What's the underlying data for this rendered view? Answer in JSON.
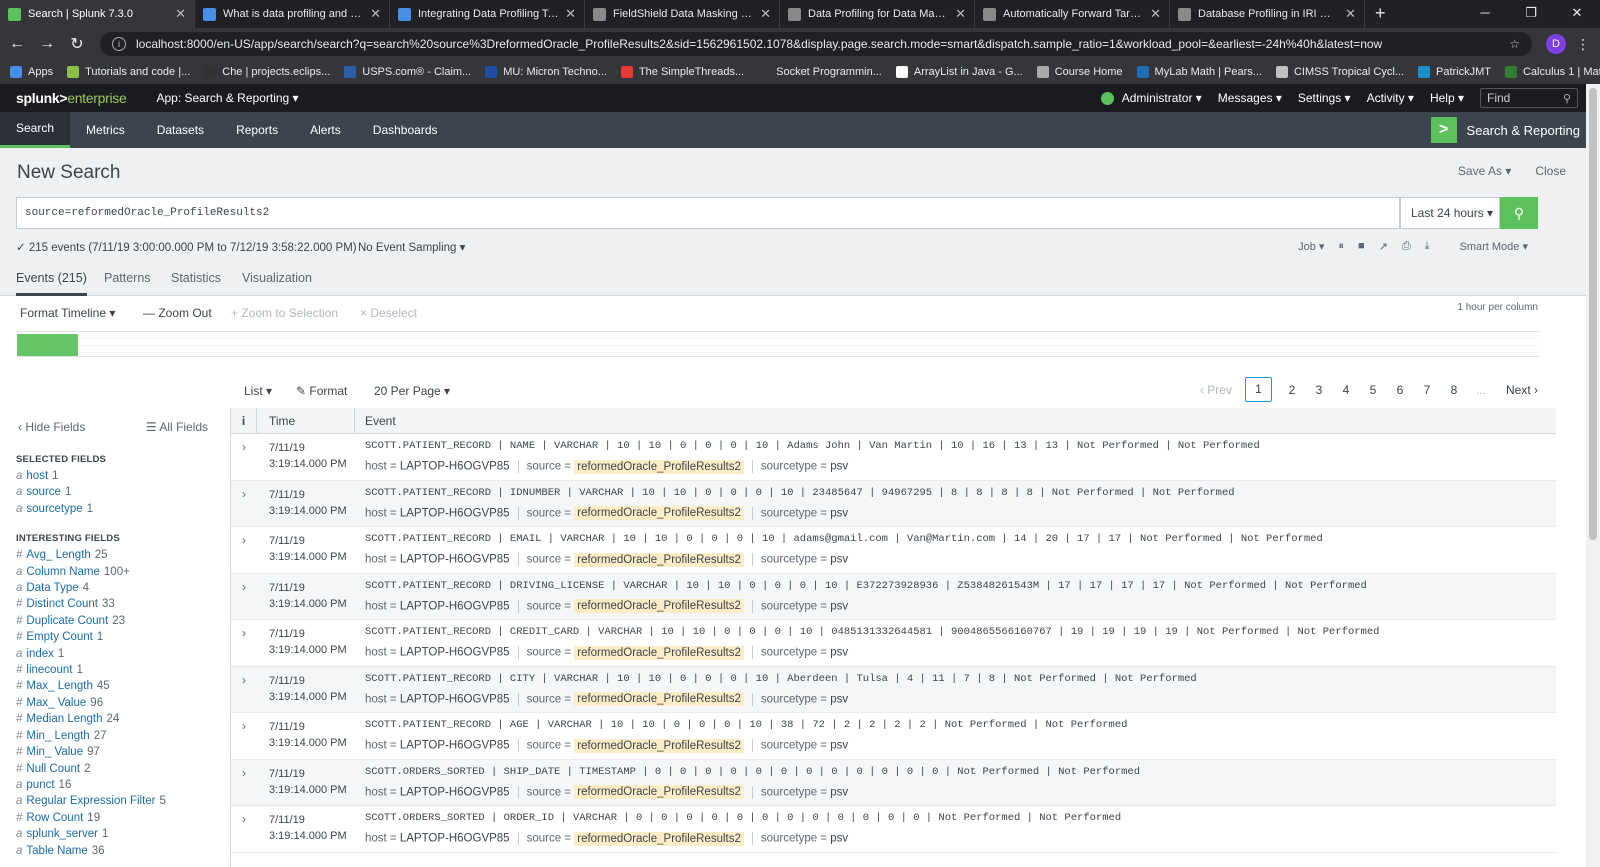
{
  "browser": {
    "tabs": [
      {
        "title": "Search | Splunk 7.3.0",
        "active": true,
        "color": "#5cc05c"
      },
      {
        "title": "What is data profiling and how d",
        "active": false,
        "color": "#4a8fe7"
      },
      {
        "title": "Integrating Data Profiling Tools i",
        "active": false,
        "color": "#4a8fe7"
      },
      {
        "title": "FieldShield Data Masking Softwa",
        "active": false,
        "color": "#888888"
      },
      {
        "title": "Data Profiling for Data Masking i",
        "active": false,
        "color": "#888888"
      },
      {
        "title": "Automatically Forward Target or",
        "active": false,
        "color": "#888888"
      },
      {
        "title": "Database Profiling in IRI Workbe",
        "active": false,
        "color": "#888888"
      }
    ],
    "url": "localhost:8000/en-US/app/search/search?q=search%20source%3DreformedOracle_ProfileResults2&sid=1562961502.1078&display.page.search.mode=smart&dispatch.sample_ratio=1&workload_pool=&earliest=-24h%40h&latest=now",
    "profile_initial": "D",
    "bookmarks": [
      {
        "label": "Apps",
        "color": "#4a8fe7"
      },
      {
        "label": "Tutorials and code |...",
        "color": "#8bc34a"
      },
      {
        "label": "Che | projects.eclips...",
        "color": "#333333"
      },
      {
        "label": "USPS.com® - Claim...",
        "color": "#2b5ea8"
      },
      {
        "label": "MU: Micron Techno...",
        "color": "#1f4fa0"
      },
      {
        "label": "The SimpleThreads...",
        "color": "#e53935"
      },
      {
        "label": "Socket Programmin...",
        "color": "#35363a"
      },
      {
        "label": "ArrayList in Java - G...",
        "color": "#ffffff"
      },
      {
        "label": "Course Home",
        "color": "#aaaaaa"
      },
      {
        "label": "MyLab Math | Pears...",
        "color": "#1f6fb2"
      },
      {
        "label": "CIMSS Tropical Cycl...",
        "color": "#c0c0c0"
      },
      {
        "label": "PatrickJMT",
        "color": "#1e90c9"
      },
      {
        "label": "Calculus 1 | Math |...",
        "color": "#2e7d32"
      }
    ]
  },
  "splunk": {
    "logo_main": "splunk>",
    "logo_sub": "enterprise",
    "app_menu": "App: Search & Reporting ▾",
    "top_menu": [
      "Administrator ▾",
      "Messages ▾",
      "Settings ▾",
      "Activity ▾",
      "Help ▾"
    ],
    "find_placeholder": "Find",
    "nav": [
      "Search",
      "Metrics",
      "Datasets",
      "Reports",
      "Alerts",
      "Dashboards"
    ],
    "app_badge": "Search & Reporting",
    "page_title": "New Search",
    "save_as": "Save As ▾",
    "close": "Close",
    "query": "source=reformedOracle_ProfileResults2",
    "time_range": "Last 24 hours ▾",
    "job_status": "✓ 215 events (7/11/19 3:00:00.000 PM to 7/12/19 3:58:22.000 PM)",
    "sampling": "No Event Sampling ▾",
    "job_menu": "Job ▾",
    "mode": "Smart Mode ▾",
    "sub_tabs": [
      "Events (215)",
      "Patterns",
      "Statistics",
      "Visualization"
    ],
    "timeline": {
      "format": "Format Timeline ▾",
      "zoom_out": "— Zoom Out",
      "zoom_sel": "+ Zoom to Selection",
      "deselect": "× Deselect",
      "scale": "1 hour per column"
    },
    "results_bar": {
      "list": "List ▾",
      "format": "✎ Format",
      "per_page": "20 Per Page ▾",
      "prev": "‹ Prev",
      "pages": [
        "1",
        "2",
        "3",
        "4",
        "5",
        "6",
        "7",
        "8"
      ],
      "ellipsis": "...",
      "next": "Next ›"
    },
    "sidebar": {
      "hide_fields": "‹ Hide Fields",
      "all_fields": "☰ All Fields",
      "selected_title": "SELECTED FIELDS",
      "selected": [
        {
          "type": "a",
          "name": "host",
          "count": "1"
        },
        {
          "type": "a",
          "name": "source",
          "count": "1"
        },
        {
          "type": "a",
          "name": "sourcetype",
          "count": "1"
        }
      ],
      "interesting_title": "INTERESTING FIELDS",
      "interesting": [
        {
          "type": "#",
          "name": "Avg_ Length",
          "count": "25"
        },
        {
          "type": "a",
          "name": "Column Name",
          "count": "100+"
        },
        {
          "type": "a",
          "name": "Data Type",
          "count": "4"
        },
        {
          "type": "#",
          "name": "Distinct Count",
          "count": "33"
        },
        {
          "type": "#",
          "name": "Duplicate Count",
          "count": "23"
        },
        {
          "type": "#",
          "name": "Empty Count",
          "count": "1"
        },
        {
          "type": "a",
          "name": "index",
          "count": "1"
        },
        {
          "type": "#",
          "name": "linecount",
          "count": "1"
        },
        {
          "type": "#",
          "name": "Max_ Length",
          "count": "45"
        },
        {
          "type": "#",
          "name": "Max_ Value",
          "count": "96"
        },
        {
          "type": "#",
          "name": "Median Length",
          "count": "24"
        },
        {
          "type": "#",
          "name": "Min_ Length",
          "count": "27"
        },
        {
          "type": "#",
          "name": "Min_ Value",
          "count": "97"
        },
        {
          "type": "#",
          "name": "Null Count",
          "count": "2"
        },
        {
          "type": "a",
          "name": "punct",
          "count": "16"
        },
        {
          "type": "a",
          "name": "Regular Expression Filter",
          "count": "5"
        },
        {
          "type": "#",
          "name": "Row Count",
          "count": "19"
        },
        {
          "type": "a",
          "name": "splunk_server",
          "count": "1"
        },
        {
          "type": "a",
          "name": "Table Name",
          "count": "36"
        }
      ]
    },
    "events_header": {
      "i": "i",
      "time": "Time",
      "event": "Event"
    },
    "events": [
      {
        "date": "7/11/19",
        "time": "3:19:14.000 PM",
        "raw": "SCOTT.PATIENT_RECORD | NAME | VARCHAR | 10 | 10 | 0 | 0 | 0 | 10 | Adams John | Van Martin | 10 | 16 | 13 | 13 | Not Performed | Not Performed"
      },
      {
        "date": "7/11/19",
        "time": "3:19:14.000 PM",
        "raw": "SCOTT.PATIENT_RECORD | IDNUMBER | VARCHAR | 10 | 10 | 0 | 0 | 0 | 10 | 23485647 | 94967295 | 8 | 8 | 8 | 8 | Not Performed | Not Performed"
      },
      {
        "date": "7/11/19",
        "time": "3:19:14.000 PM",
        "raw": "SCOTT.PATIENT_RECORD | EMAIL | VARCHAR | 10 | 10 | 0 | 0 | 0 | 10 | adams@gmail.com | Van@Martin.com | 14 | 20 | 17 | 17 | Not Performed | Not Performed"
      },
      {
        "date": "7/11/19",
        "time": "3:19:14.000 PM",
        "raw": "SCOTT.PATIENT_RECORD | DRIVING_LICENSE | VARCHAR | 10 | 10 | 0 | 0 | 0 | 10 | E372273928936 | Z53848261543M | 17 | 17 | 17 | 17 | Not Performed | Not Performed"
      },
      {
        "date": "7/11/19",
        "time": "3:19:14.000 PM",
        "raw": "SCOTT.PATIENT_RECORD | CREDIT_CARD | VARCHAR | 10 | 10 | 0 | 0 | 0 | 10 | 0485131332644581 | 9004865566160767 | 19 | 19 | 19 | 19 | Not Performed | Not Performed"
      },
      {
        "date": "7/11/19",
        "time": "3:19:14.000 PM",
        "raw": "SCOTT.PATIENT_RECORD | CITY | VARCHAR | 10 | 10 | 0 | 0 | 0 | 10 | Aberdeen | Tulsa | 4 | 11 | 7 | 8 | Not Performed | Not Performed"
      },
      {
        "date": "7/11/19",
        "time": "3:19:14.000 PM",
        "raw": "SCOTT.PATIENT_RECORD | AGE | VARCHAR | 10 | 10 | 0 | 0 | 0 | 10 | 38 | 72 | 2 | 2 | 2 | 2 | Not Performed | Not Performed"
      },
      {
        "date": "7/11/19",
        "time": "3:19:14.000 PM",
        "raw": "SCOTT.ORDERS_SORTED | SHIP_DATE | TIMESTAMP | 0 | 0 | 0 | 0 | 0 | 0 | 0 | 0 | 0 | 0 | 0 | 0 | Not Performed | Not Performed"
      },
      {
        "date": "7/11/19",
        "time": "3:19:14.000 PM",
        "raw": "SCOTT.ORDERS_SORTED | ORDER_ID | VARCHAR | 0 | 0 | 0 | 0 | 0 | 0 | 0 | 0 | 0 | 0 | 0 | 0 | Not Performed | Not Performed"
      }
    ],
    "event_meta": {
      "host_key": "host =",
      "host": "LAPTOP-H6OGVP85",
      "source_key": "source =",
      "source": "reformedOracle_ProfileResults2",
      "sourcetype_key": "sourcetype =",
      "sourcetype": "psv"
    }
  }
}
